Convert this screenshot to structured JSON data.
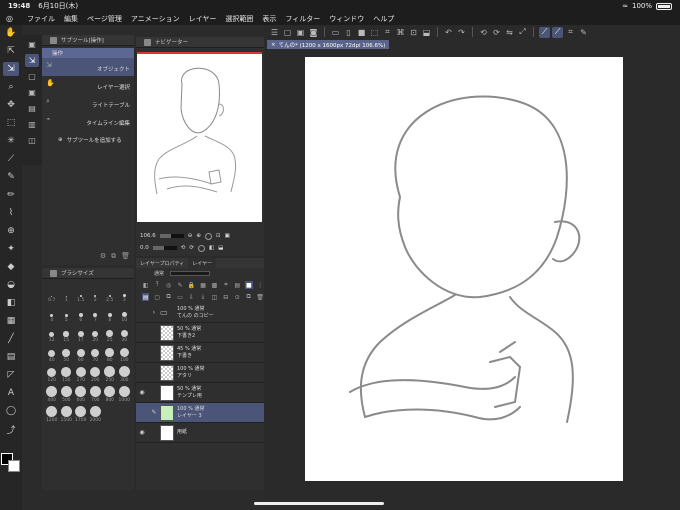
{
  "status": {
    "time": "19:48",
    "date": "6月10日(木)",
    "battery": "100%"
  },
  "menu": [
    "ファイル",
    "編集",
    "ページ管理",
    "アニメーション",
    "レイヤー",
    "選択範囲",
    "表示",
    "フィルター",
    "ウィンドウ",
    "ヘルプ"
  ],
  "subtool": {
    "tab": "サブツール[操作]",
    "header": "操作",
    "items": [
      "オブジェクト",
      "レイヤー選択",
      "ライトテーブル",
      "タイムライン編集"
    ],
    "add_label": "サブツールを追加する"
  },
  "brush": {
    "tab": "ブラシサイズ",
    "sizes": [
      "0.7",
      "1",
      "1.5",
      "2",
      "2.5",
      "3",
      "4",
      "5",
      "6",
      "7",
      "8",
      "10",
      "12",
      "15",
      "17",
      "20",
      "25",
      "30",
      "40",
      "50",
      "60",
      "70",
      "80",
      "100",
      "120",
      "150",
      "170",
      "200",
      "250",
      "300",
      "400",
      "500",
      "600",
      "700",
      "800",
      "1000",
      "1200",
      "1500",
      "1700",
      "2000"
    ]
  },
  "navigator": {
    "tab": "ナビゲーター",
    "zoom": "106.6",
    "rotate": "0.0"
  },
  "layers": {
    "tabs": [
      "レイヤープロパティ",
      "レイヤー"
    ],
    "blend_mode": "通常",
    "items": [
      {
        "mode": "100 % 通常",
        "name": "てんの のコピー",
        "type": "folder",
        "eye": ""
      },
      {
        "mode": "50 % 通常",
        "name": "下書き2",
        "type": "checker",
        "eye": ""
      },
      {
        "mode": "45 % 通常",
        "name": "下書き",
        "type": "checker",
        "eye": ""
      },
      {
        "mode": "100 % 通常",
        "name": "アタリ",
        "type": "checker",
        "eye": ""
      },
      {
        "mode": "50 % 通常",
        "name": "テンプレ用",
        "type": "white",
        "eye": "◉"
      },
      {
        "mode": "100 % 通常",
        "name": "レイヤー 3",
        "type": "green",
        "eye": ""
      },
      {
        "mode": "",
        "name": "用紙",
        "type": "white",
        "eye": "◉"
      }
    ]
  },
  "document": {
    "tab": "てんの* (1200 x 1600px 72dpi 106.6%)"
  }
}
